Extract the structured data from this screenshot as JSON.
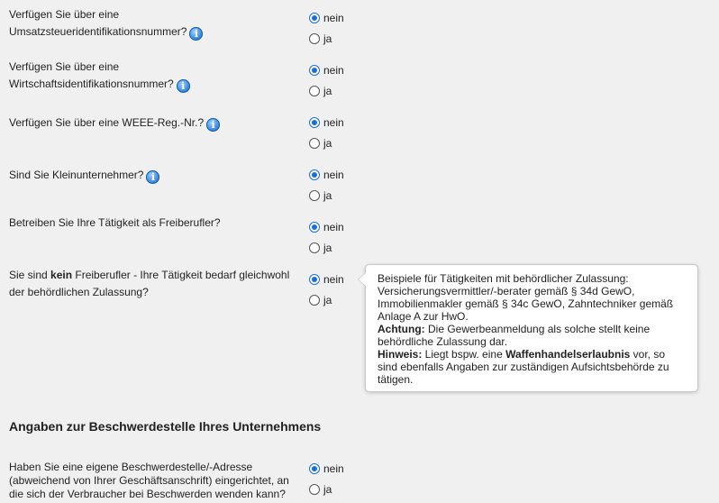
{
  "options": {
    "nein": "nein",
    "ja": "ja"
  },
  "questions": [
    {
      "id": "ust",
      "line1": "Verfügen Sie über eine",
      "line2": "Umsatzsteueridentifikationsnummer?",
      "selected": "nein"
    },
    {
      "id": "wid",
      "line1": "Verfügen Sie über eine",
      "line2": "Wirtschaftsidentifikationsnummer?",
      "selected": "nein"
    },
    {
      "id": "weee",
      "text": "Verfügen Sie über eine WEEE-Reg.-Nr.?",
      "selected": "nein"
    },
    {
      "id": "klein",
      "text": "Sind Sie Kleinunternehmer?",
      "selected": "nein"
    },
    {
      "id": "freib",
      "text": "Betreiben Sie Ihre Tätigkeit als Freiberufler?",
      "selected": "nein"
    },
    {
      "id": "zul",
      "pre": "Sie sind ",
      "bold": "kein",
      "post": " Freiberufler - Ihre Tätigkeit bedarf gleichwohl",
      "line2": "der behördlichen Zulassung?",
      "selected": "nein"
    },
    {
      "id": "besch",
      "line1": "Haben Sie eine eigene Beschwerdestelle/-Adresse",
      "line2": "(abweichend von Ihrer Geschäftsanschrift) eingerichtet, an",
      "line3": "die sich der Verbraucher bei Beschwerden wenden kann?",
      "selected": "nein"
    }
  ],
  "tooltip": {
    "line1": "Beispiele für Tätigkeiten mit behördlicher Zulassung:",
    "line2": "Versicherungsvermittler/-berater gemäß § 34d GewO,",
    "line3": "Immobilienmakler gemäß § 34c GewO, Zahntechniker gemäß",
    "line4": "Anlage A zur HwO.",
    "achtung_label": "Achtung:",
    "achtung_text": " Die Gewerbeanmeldung als solche stellt keine",
    "achtung_line2": "behördliche Zulassung dar.",
    "hinweis_label": "Hinweis:",
    "hinweis_text": " Liegt bspw. eine ",
    "hinweis_bold": "Waffenhandelserlaubnis",
    "hinweis_post": " vor, so",
    "hinweis_line2": "sind ebenfalls Angaben zur zuständigen Aufsichtsbehörde zu",
    "hinweis_line3": "tätigen."
  },
  "section": {
    "heading": "Angaben zur Beschwerdestelle Ihres Unternehmens"
  },
  "icons": {
    "info": "info-icon"
  }
}
